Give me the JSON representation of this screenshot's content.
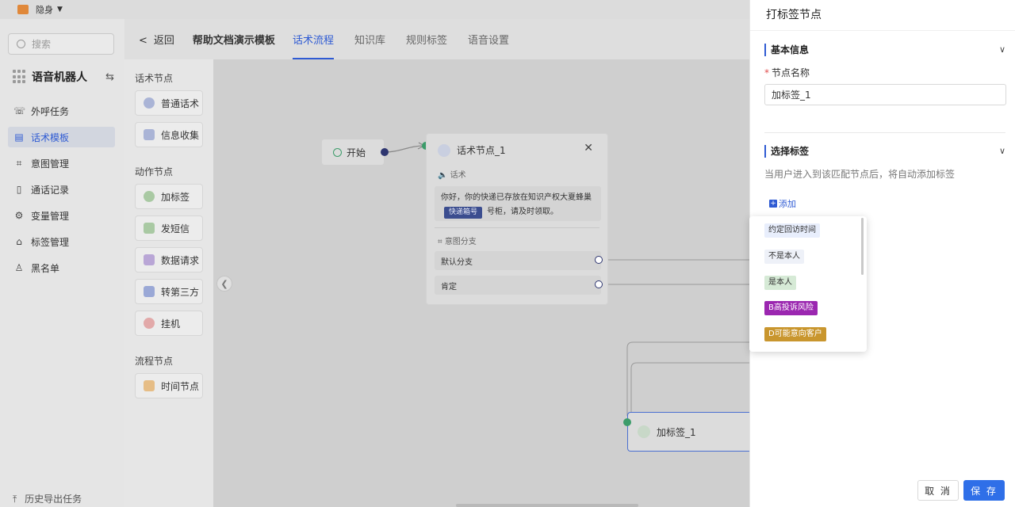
{
  "topbar": {
    "name": "隐身"
  },
  "sidebar": {
    "search_placeholder": "搜索",
    "brand": "语音机器人",
    "items": [
      {
        "label": "外呼任务",
        "icon": "phone-icon"
      },
      {
        "label": "话术模板",
        "icon": "document-icon",
        "active": true
      },
      {
        "label": "意图管理",
        "icon": "scan-icon"
      },
      {
        "label": "通话记录",
        "icon": "record-icon"
      },
      {
        "label": "变量管理",
        "icon": "variable-icon"
      },
      {
        "label": "标签管理",
        "icon": "tag-icon"
      },
      {
        "label": "黑名单",
        "icon": "user-icon"
      }
    ],
    "export": "历史导出任务"
  },
  "header": {
    "back": "返回",
    "template_title": "帮助文档演示模板",
    "tabs": [
      {
        "label": "话术流程",
        "active": true
      },
      {
        "label": "知识库"
      },
      {
        "label": "规则标签"
      },
      {
        "label": "语音设置"
      }
    ]
  },
  "palette": {
    "groups": {
      "speech": "话术节点",
      "action": "动作节点",
      "flow": "流程节点"
    },
    "speech_items": [
      "普通话术",
      "信息收集"
    ],
    "action_items": [
      "加标签",
      "发短信",
      "数据请求",
      "转第三方",
      "挂机"
    ],
    "flow_items": [
      "时间节点"
    ]
  },
  "canvas": {
    "start_node": "开始",
    "speech_node": {
      "title": "话术节点_1",
      "section": "话术",
      "message_line1": "你好，你的快递已存放在知识产权大夏蜂巢",
      "chip": "快递箱号",
      "message_line2": "号柜，请及时领取。",
      "intent_section": "意图分支",
      "branches": [
        "默认分支",
        "肯定"
      ]
    },
    "tag_node": "加标签_1"
  },
  "panel": {
    "title": "打标签节点",
    "basic_section": "基本信息",
    "node_name_label": "节点名称",
    "node_name_value": "加标签_1",
    "tag_section": "选择标签",
    "description": "当用户进入到该匹配节点后，将自动添加标签",
    "add": "添加",
    "cancel": "取 消",
    "save": "保 存"
  },
  "dropdown": {
    "tags": [
      {
        "label": "约定回访时间",
        "bg": "#e8eefc",
        "fg": "#333333"
      },
      {
        "label": "不是本人",
        "bg": "#eef1f8",
        "fg": "#333333"
      },
      {
        "label": "是本人",
        "bg": "#d6ead6",
        "fg": "#333333"
      },
      {
        "label": "B高投诉风险",
        "bg": "#9b27b0",
        "fg": "#ffffff"
      },
      {
        "label": "D可能意向客户",
        "bg": "#c9962e",
        "fg": "#ffffff"
      }
    ]
  },
  "colors": {
    "accent": "#2f5bd3",
    "save_button": "#2f6fe8",
    "chip": "#3b4d8f"
  }
}
